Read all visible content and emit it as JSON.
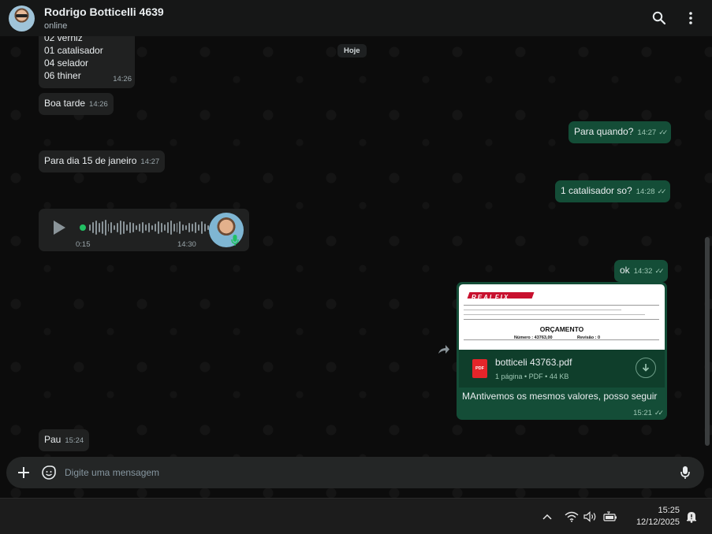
{
  "header": {
    "contact_name": "Rodrigo Botticelli 4639",
    "status": "online",
    "search_icon": "search-icon",
    "menu_icon": "kebab-menu-icon"
  },
  "chat": {
    "date_chip": "Hoje",
    "messages": [
      {
        "type": "text",
        "direction": "in",
        "lines": [
          "02 verniz",
          "01 catalisador",
          "04 selador",
          "06 thiner"
        ],
        "time": "14:26"
      },
      {
        "type": "text",
        "direction": "in",
        "text": "Boa tarde",
        "time": "14:26"
      },
      {
        "type": "text",
        "direction": "out",
        "text": "Para quando?",
        "time": "14:27"
      },
      {
        "type": "text",
        "direction": "in",
        "text": "Para dia 15 de janeiro",
        "time": "14:27"
      },
      {
        "type": "text",
        "direction": "out",
        "text": "1 catalisador so?",
        "time": "14:28"
      },
      {
        "type": "audio",
        "direction": "in",
        "duration": "0:15",
        "time": "14:30"
      },
      {
        "type": "text",
        "direction": "out",
        "text": "ok",
        "time": "14:32"
      },
      {
        "type": "document",
        "direction": "out",
        "preview": {
          "logo": "REALFIX",
          "title": "ORÇAMENTO",
          "number_label": "Número :",
          "number_value": "43763,00",
          "revision_label": "Revisão :",
          "revision_value": "0"
        },
        "file_name": "botticeli 43763.pdf",
        "file_meta": "1 página • PDF • 44 KB",
        "file_badge": "PDF",
        "caption": "MAntivemos os mesmos valores, posso seguir",
        "time": "15:21"
      },
      {
        "type": "text",
        "direction": "in",
        "text": "Pau",
        "time": "15:24"
      }
    ]
  },
  "composer": {
    "placeholder": "Digite uma mensagem"
  },
  "taskbar": {
    "time": "15:25",
    "date": "12/12/2025"
  },
  "colors": {
    "incoming_bubble": "#202121",
    "outgoing_bubble": "#144d37",
    "accent_green": "#21c063",
    "pdf_red": "#e5252a"
  }
}
